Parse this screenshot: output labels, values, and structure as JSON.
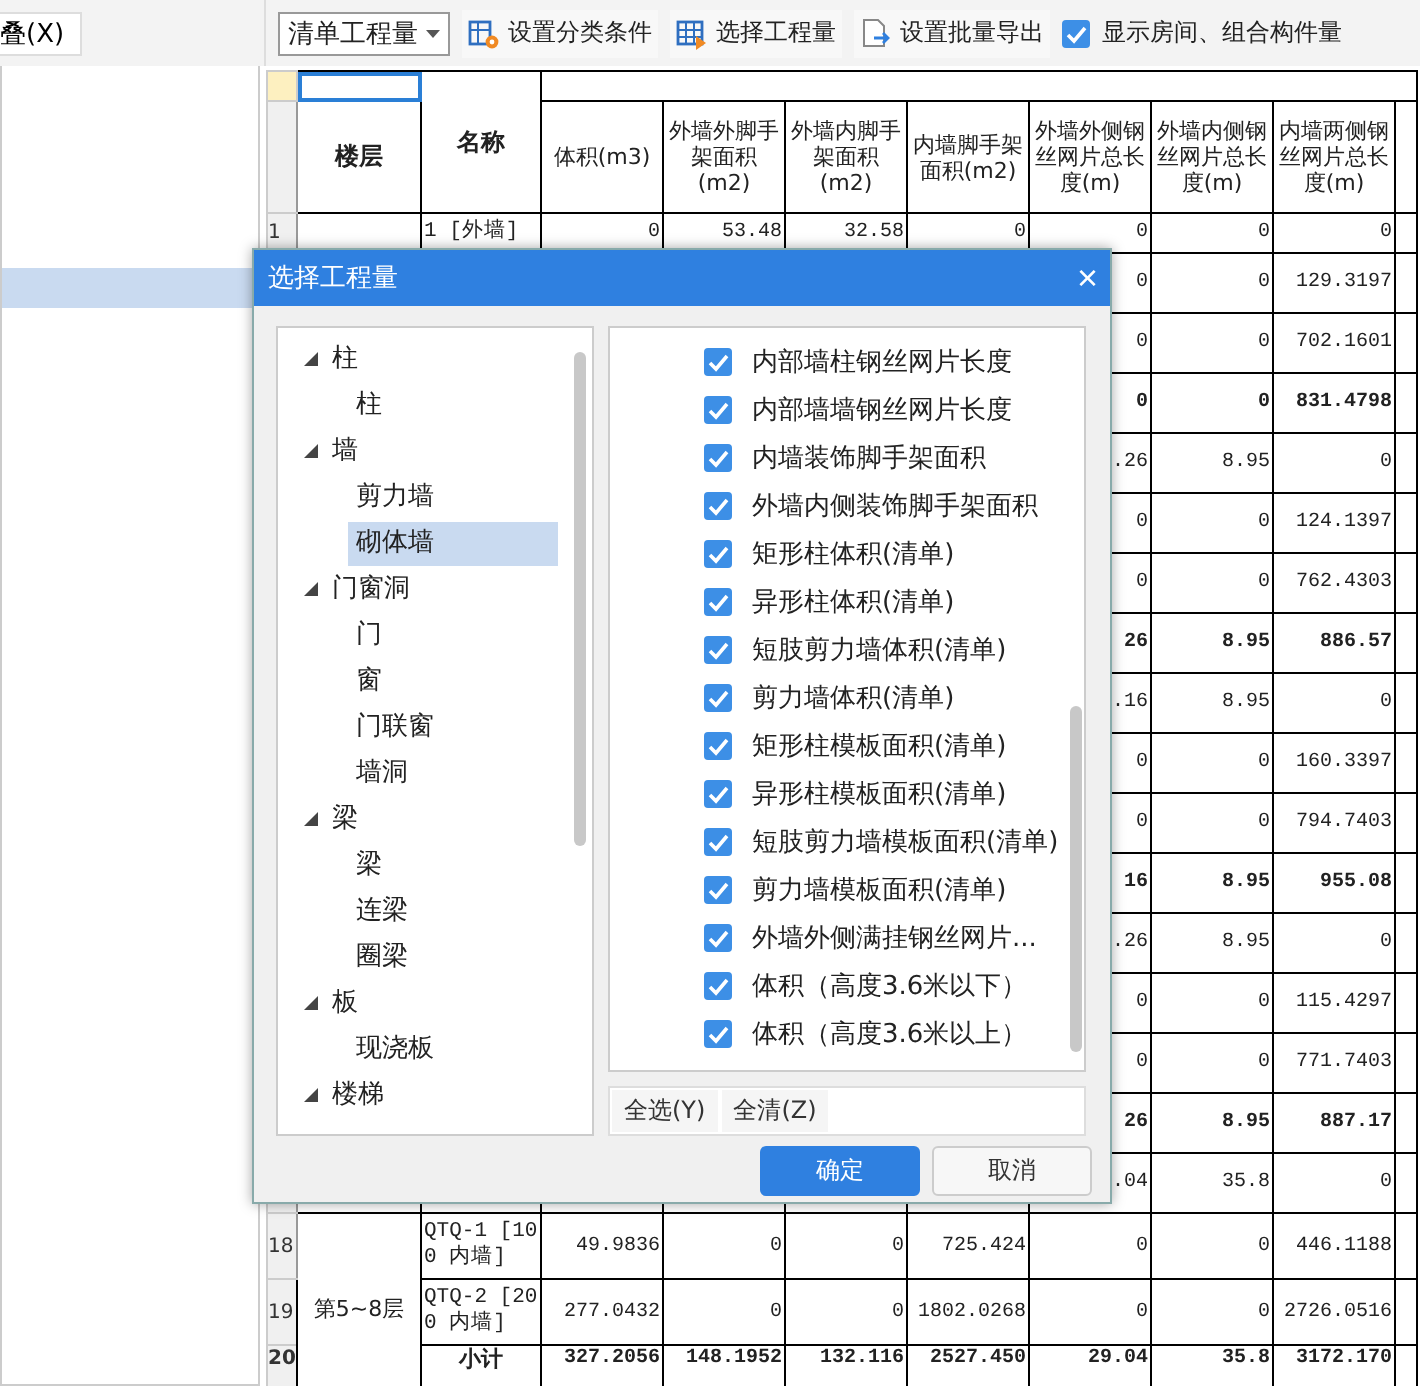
{
  "toolbar": {
    "left_button": "叠(X)",
    "dropdown": "清单工程量",
    "buttons": [
      {
        "kind": "classify",
        "label": "设置分类条件"
      },
      {
        "kind": "select",
        "label": "选择工程量"
      },
      {
        "kind": "export",
        "label": "设置批量导出"
      }
    ],
    "checkbox": {
      "label": "显示房间、组合构件量",
      "checked": true
    }
  },
  "left_panel": {
    "rows": [
      {
        "selected": true
      }
    ]
  },
  "table": {
    "floor_header": "楼层",
    "name_header": "名称",
    "columns": [
      "体积(m3)",
      "外墙外脚手架面积(m2)",
      "外墙内脚手架面积(m2)",
      "内墙脚手架面积(m2)",
      "外墙外侧钢丝网片总长度(m)",
      "外墙内侧钢丝网片总长度(m)",
      "内墙两侧钢丝网片总长度(m)"
    ],
    "rows": [
      {
        "kind": "item",
        "no": "1",
        "name": "1 [外墙]",
        "cells": [
          "0",
          "53.48",
          "32.58",
          "0",
          "0",
          "0",
          "0"
        ]
      },
      {
        "kind": "item",
        "cells": [
          "0",
          "0",
          "129.3197"
        ]
      },
      {
        "kind": "item",
        "cells": [
          "0",
          "0",
          "702.1601"
        ]
      },
      {
        "kind": "subtotal",
        "cells": [
          "0",
          "0",
          "831.4798"
        ]
      },
      {
        "kind": "item",
        "cells": [
          ".26",
          "8.95",
          "0"
        ]
      },
      {
        "kind": "item",
        "cells": [
          "0",
          "0",
          "124.1397"
        ]
      },
      {
        "kind": "item",
        "cells": [
          "0",
          "0",
          "762.4303"
        ]
      },
      {
        "kind": "subtotal",
        "cells": [
          "26",
          "8.95",
          "886.57"
        ]
      },
      {
        "kind": "item",
        "cells": [
          ".16",
          "8.95",
          "0"
        ]
      },
      {
        "kind": "item",
        "cells": [
          "0",
          "0",
          "160.3397"
        ]
      },
      {
        "kind": "item",
        "cells": [
          "0",
          "0",
          "794.7403"
        ]
      },
      {
        "kind": "subtotal",
        "cells": [
          "16",
          "8.95",
          "955.08"
        ]
      },
      {
        "kind": "item",
        "cells": [
          ".26",
          "8.95",
          "0"
        ]
      },
      {
        "kind": "item",
        "cells": [
          "0",
          "0",
          "115.4297"
        ]
      },
      {
        "kind": "item",
        "cells": [
          "0",
          "0",
          "771.7403"
        ]
      },
      {
        "kind": "subtotal",
        "cells": [
          "26",
          "8.95",
          "887.17"
        ]
      },
      {
        "kind": "item",
        "cells": [
          ".04",
          "35.8",
          "0"
        ]
      },
      {
        "kind": "item",
        "no": "18",
        "floor": "第5~8层",
        "name": "QTQ-1 [100 内墙]",
        "cells": [
          "49.9836",
          "0",
          "0",
          "725.424",
          "0",
          "0",
          "446.1188"
        ]
      },
      {
        "kind": "item",
        "no": "19",
        "name": "QTQ-2 [200 内墙]",
        "cells": [
          "277.0432",
          "0",
          "0",
          "1802.0268",
          "0",
          "0",
          "2726.0516"
        ]
      },
      {
        "kind": "subtotal",
        "no": "20",
        "name": "小计",
        "cells": [
          "327.2056",
          "148.1952",
          "132.116",
          "2527.450",
          "29.04",
          "35.8",
          "3172.170"
        ]
      }
    ]
  },
  "dialog": {
    "title": "选择工程量",
    "close": "×",
    "tree": [
      {
        "label": "柱",
        "expanded": true,
        "selected": false,
        "children": [
          {
            "label": "柱",
            "selected": false
          }
        ]
      },
      {
        "label": "墙",
        "expanded": true,
        "selected": false,
        "children": [
          {
            "label": "剪力墙",
            "selected": false
          },
          {
            "label": "砌体墙",
            "selected": true
          }
        ]
      },
      {
        "label": "门窗洞",
        "expanded": true,
        "selected": false,
        "children": [
          {
            "label": "门",
            "selected": false
          },
          {
            "label": "窗",
            "selected": false
          },
          {
            "label": "门联窗",
            "selected": false
          },
          {
            "label": "墙洞",
            "selected": false
          }
        ]
      },
      {
        "label": "梁",
        "expanded": true,
        "selected": false,
        "children": [
          {
            "label": "梁",
            "selected": false
          },
          {
            "label": "连梁",
            "selected": false
          },
          {
            "label": "圈梁",
            "selected": false
          }
        ]
      },
      {
        "label": "板",
        "expanded": true,
        "selected": false,
        "children": [
          {
            "label": "现浇板",
            "selected": false
          }
        ]
      },
      {
        "label": "楼梯",
        "expanded": true,
        "selected": false
      }
    ],
    "quantities": [
      {
        "label": "内部墙柱钢丝网片长度",
        "checked": true
      },
      {
        "label": "内部墙墙钢丝网片长度",
        "checked": true
      },
      {
        "label": "内墙装饰脚手架面积",
        "checked": true
      },
      {
        "label": "外墙内侧装饰脚手架面积",
        "checked": true
      },
      {
        "label": "矩形柱体积(清单)",
        "checked": true
      },
      {
        "label": "异形柱体积(清单)",
        "checked": true
      },
      {
        "label": "短肢剪力墙体积(清单)",
        "checked": true
      },
      {
        "label": "剪力墙体积(清单)",
        "checked": true
      },
      {
        "label": "矩形柱模板面积(清单)",
        "checked": true
      },
      {
        "label": "异形柱模板面积(清单)",
        "checked": true
      },
      {
        "label": "短肢剪力墙模板面积(清单)",
        "checked": true
      },
      {
        "label": "剪力墙模板面积(清单)",
        "checked": true
      },
      {
        "label": "外墙外侧满挂钢丝网片...",
        "checked": true
      },
      {
        "label": "体积（高度3.6米以下）",
        "checked": true
      },
      {
        "label": "体积（高度3.6米以上）",
        "checked": true
      }
    ],
    "select_all": "全选(Y)",
    "clear_all": "全清(Z)",
    "ok": "确定",
    "cancel": "取消"
  }
}
